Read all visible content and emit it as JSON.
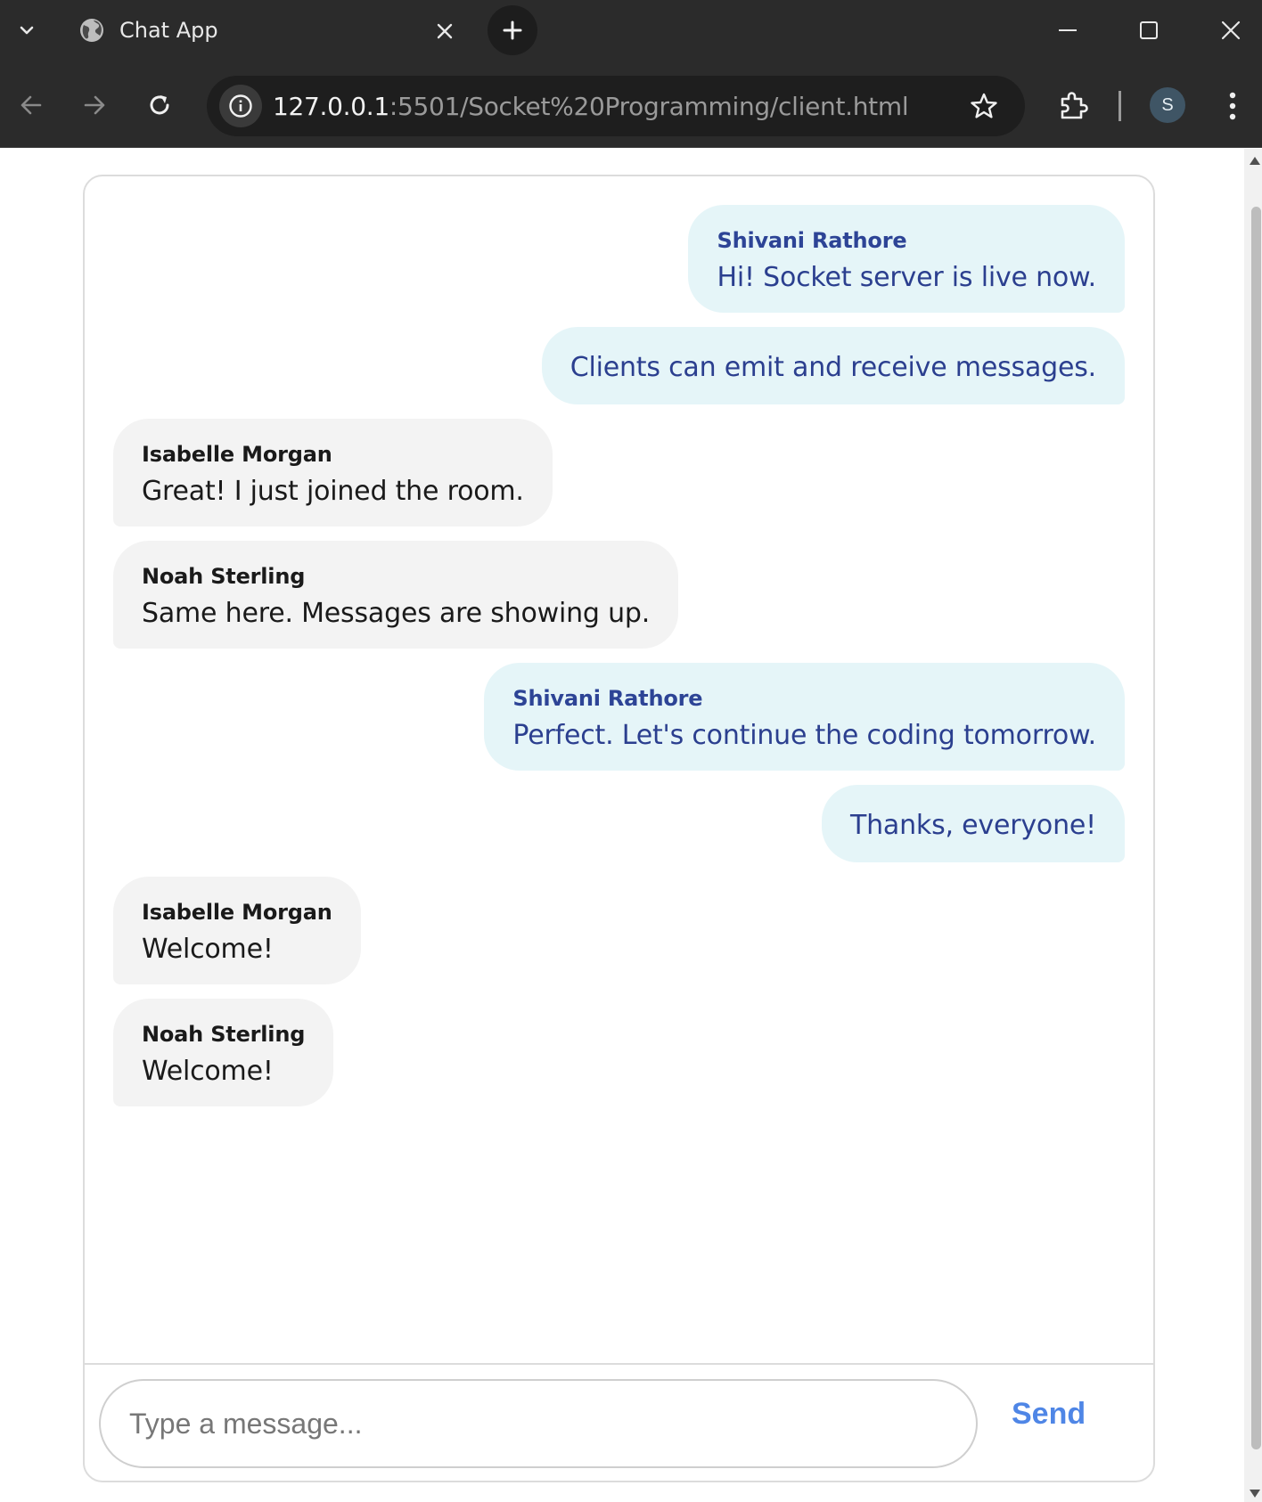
{
  "browser": {
    "tab_title": "Chat App",
    "url_host": "127.0.0.1",
    "url_path": ":5501/Socket%20Programming/client.html",
    "profile_initial": "S"
  },
  "chat": {
    "messages": [
      {
        "side": "self",
        "sender": "Shivani Rathore",
        "text": "Hi! Socket server is live now."
      },
      {
        "side": "self",
        "sender": "",
        "text": "Clients can emit and receive messages."
      },
      {
        "side": "other",
        "sender": "Isabelle Morgan",
        "text": "Great! I just joined the room."
      },
      {
        "side": "other",
        "sender": "Noah Sterling",
        "text": "Same here. Messages are showing up."
      },
      {
        "side": "self",
        "sender": "Shivani Rathore",
        "text": "Perfect. Let's continue the coding tomorrow."
      },
      {
        "side": "self",
        "sender": "",
        "text": "Thanks, everyone!"
      },
      {
        "side": "other",
        "sender": "Isabelle Morgan",
        "text": "Welcome!"
      },
      {
        "side": "other",
        "sender": "Noah Sterling",
        "text": "Welcome!"
      }
    ],
    "composer": {
      "placeholder": "Type a message...",
      "value": "",
      "send_label": "Send"
    }
  },
  "colors": {
    "self_bubble": "#e5f5f8",
    "self_text": "#2b3f8f",
    "other_bubble": "#f3f3f3",
    "send_accent": "#4f86e6"
  }
}
